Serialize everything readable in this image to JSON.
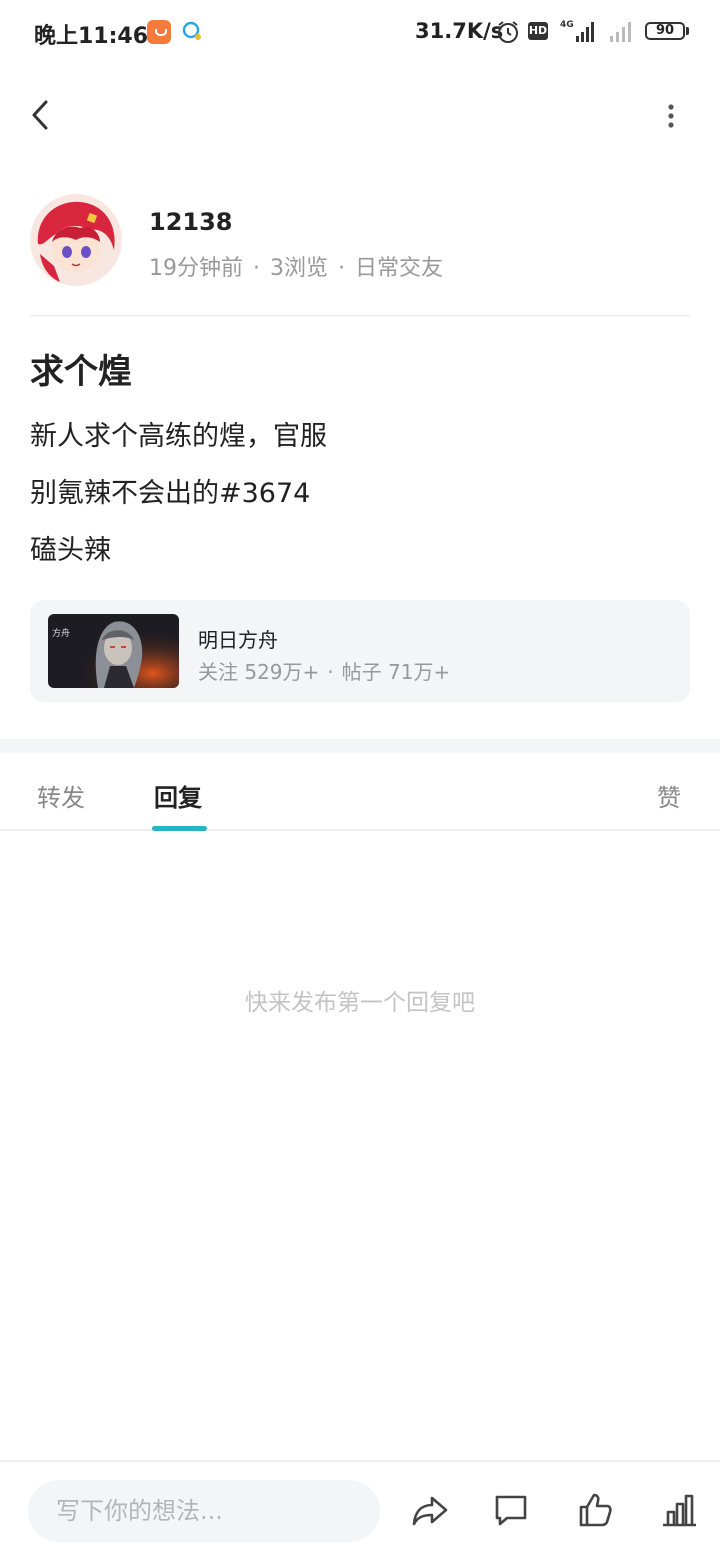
{
  "status_bar": {
    "time": "晚上11:46",
    "net_speed": "31.7K/s",
    "hd": "HD",
    "network": "4G",
    "battery": "90"
  },
  "post": {
    "author": "12138",
    "time_ago": "19分钟前",
    "views": "3浏览",
    "category": "日常交友",
    "title": "求个煌",
    "body_lines": [
      "新人求个高练的煌，官服",
      "别氪辣不会出的#3674",
      "磕头辣"
    ]
  },
  "community": {
    "name": "明日方舟",
    "followers": "关注 529万+",
    "posts": "帖子 71万+"
  },
  "tabs": {
    "repost": "转发",
    "reply": "回复",
    "like": "赞"
  },
  "empty_state": "快来发布第一个回复吧",
  "bottom_bar": {
    "placeholder": "写下你的想法..."
  },
  "colors": {
    "accent": "#26b5c4",
    "muted_text": "#999999",
    "card_bg": "#f4f5f7"
  },
  "icons": [
    "back-icon",
    "more-icon",
    "share-icon",
    "comment-icon",
    "like-icon",
    "stats-icon"
  ]
}
